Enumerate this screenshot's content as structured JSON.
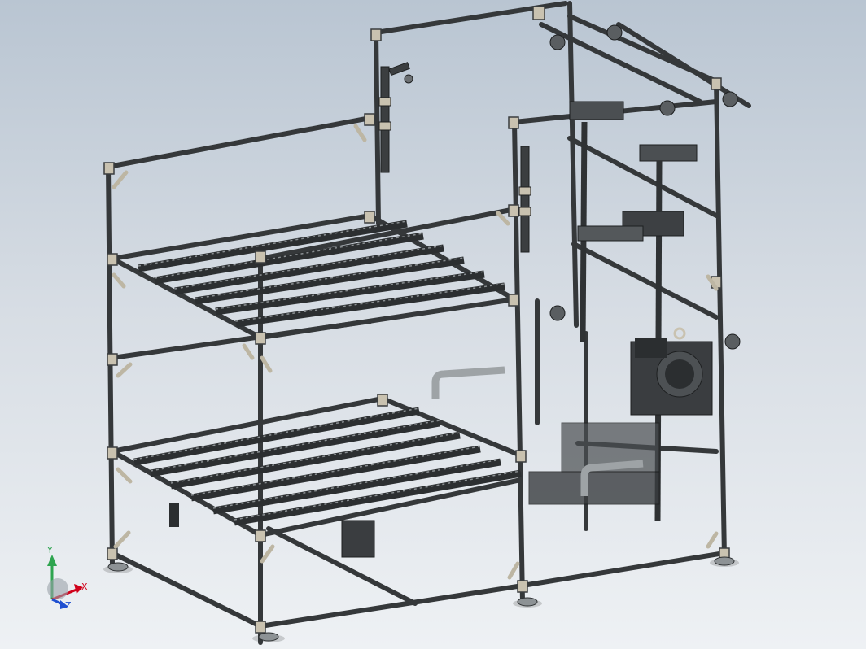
{
  "viewport": {
    "background_top": "#b9c5d2",
    "background_bottom": "#eef1f4",
    "frame_color": "#3a3d3f",
    "frame_highlight": "#7d8285",
    "connector_color": "#c9c2b0"
  },
  "triad": {
    "x_label": "X",
    "y_label": "Y",
    "z_label": "Z",
    "x_color": "#d0021b",
    "y_color": "#2ea44f",
    "z_color": "#1f4fd1"
  }
}
